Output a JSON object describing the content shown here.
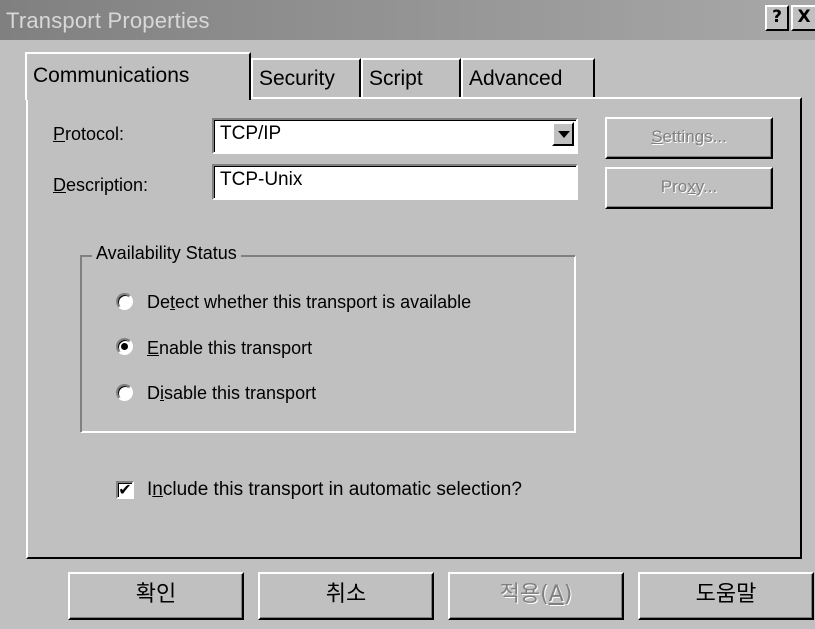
{
  "window": {
    "title": "Transport Properties",
    "help_label": "?",
    "close_label": "X"
  },
  "tabs": [
    {
      "label": "Communications",
      "active": true
    },
    {
      "label": "Security",
      "active": false
    },
    {
      "label": "Script",
      "active": false
    },
    {
      "label": "Advanced",
      "active": false
    }
  ],
  "protocol": {
    "label_mnemonic": "P",
    "label_rest": "rotocol:",
    "value": "TCP/IP"
  },
  "description": {
    "label_mnemonic": "D",
    "label_rest": "escription:",
    "value": "TCP-Unix"
  },
  "settings_button": {
    "mnemonic": "S",
    "rest": "ettings...",
    "enabled": false
  },
  "proxy_button": {
    "pre": "Pro",
    "mnemonic": "x",
    "rest": "y...",
    "enabled": false
  },
  "availability": {
    "title": "Availability Status",
    "options": [
      {
        "pre": "De",
        "mnemonic": "t",
        "rest": "ect whether this transport is available",
        "checked": false
      },
      {
        "pre": "",
        "mnemonic": "E",
        "rest": "nable this transport",
        "checked": true
      },
      {
        "pre": "D",
        "mnemonic": "i",
        "rest": "sable this transport",
        "checked": false
      }
    ]
  },
  "include_auto": {
    "pre": "I",
    "mnemonic": "n",
    "rest": "clude this transport in automatic selection?",
    "checked": true,
    "check_glyph": "✔"
  },
  "footer": {
    "ok_label": "확인",
    "cancel_label": "취소",
    "apply_pre": "적용(",
    "apply_mnemonic": "A",
    "apply_post": ")",
    "apply_enabled": false,
    "help_label": "도움말"
  }
}
